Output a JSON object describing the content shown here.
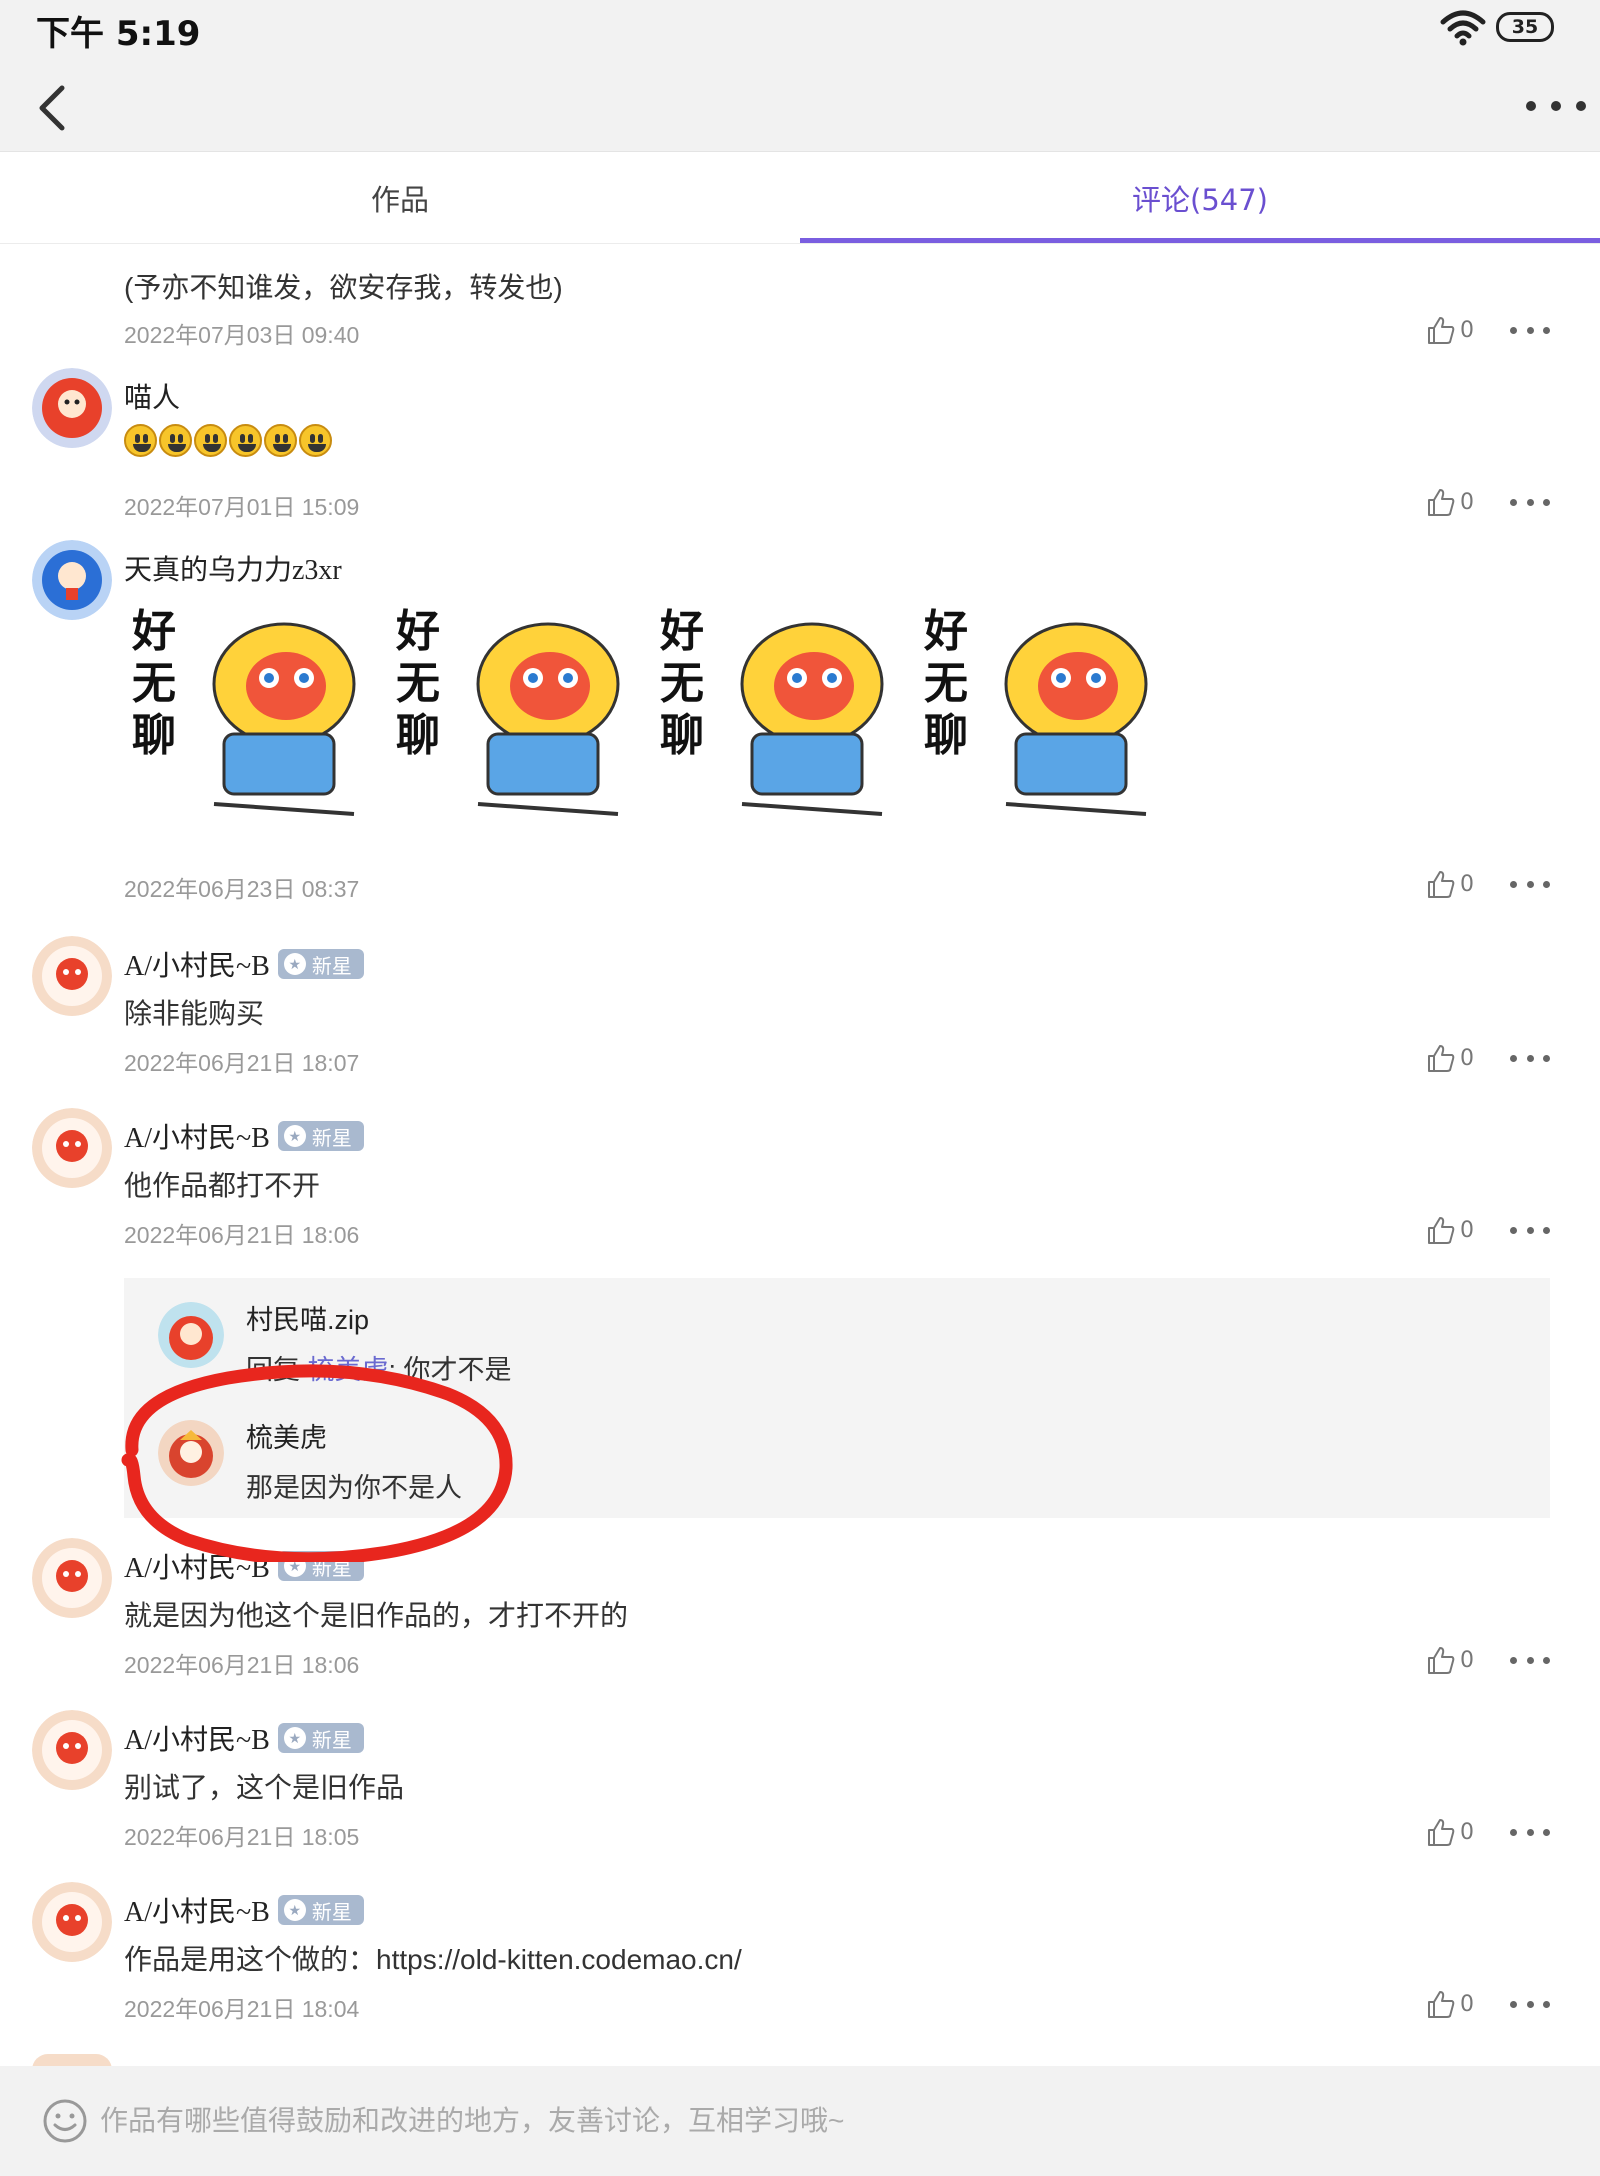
{
  "status": {
    "time": "下午 5:19",
    "battery": "35"
  },
  "tabs": [
    {
      "label": "作品"
    },
    {
      "label": "评论(547)"
    }
  ],
  "comments": [
    {
      "text": "(予亦不知谁发，欲安存我，转发也)",
      "date": "2022年07月03日 09:40",
      "likes": "0"
    },
    {
      "user": "喵人",
      "emoji_count": 6,
      "date": "2022年07月01日 15:09",
      "likes": "0"
    },
    {
      "user": "天真的乌力力z3xr",
      "sticker_text": "好无聊",
      "date": "2022年06月23日 08:37",
      "likes": "0"
    },
    {
      "user": "A/小村民~B",
      "badge": "新星",
      "text": "除非能购买",
      "date": "2022年06月21日 18:07",
      "likes": "0"
    },
    {
      "user": "A/小村民~B",
      "badge": "新星",
      "text": "他作品都打不开",
      "date": "2022年06月21日 18:06",
      "likes": "0",
      "replies": [
        {
          "user": "村民喵.zip",
          "prefix": "回复",
          "mention": "梳美虎",
          "text": ": 你才不是"
        },
        {
          "user": "梳美虎",
          "text": "那是因为你不是人"
        }
      ]
    },
    {
      "user": "A/小村民~B",
      "badge": "新星",
      "text": "就是因为他这个是旧作品的，才打不开的",
      "date": "2022年06月21日 18:06",
      "likes": "0"
    },
    {
      "user": "A/小村民~B",
      "badge": "新星",
      "text": "别试了，这个是旧作品",
      "date": "2022年06月21日 18:05",
      "likes": "0"
    },
    {
      "user": "A/小村民~B",
      "badge": "新星",
      "text": "作品是用这个做的：https://old-kitten.codemao.cn/",
      "date": "2022年06月21日 18:04",
      "likes": "0"
    }
  ],
  "input": {
    "placeholder": "作品有哪些值得鼓励和改进的地方，友善讨论，互相学习哦~"
  },
  "colors": {
    "accent": "#6a4fd0",
    "annotation": "#e8261e"
  }
}
